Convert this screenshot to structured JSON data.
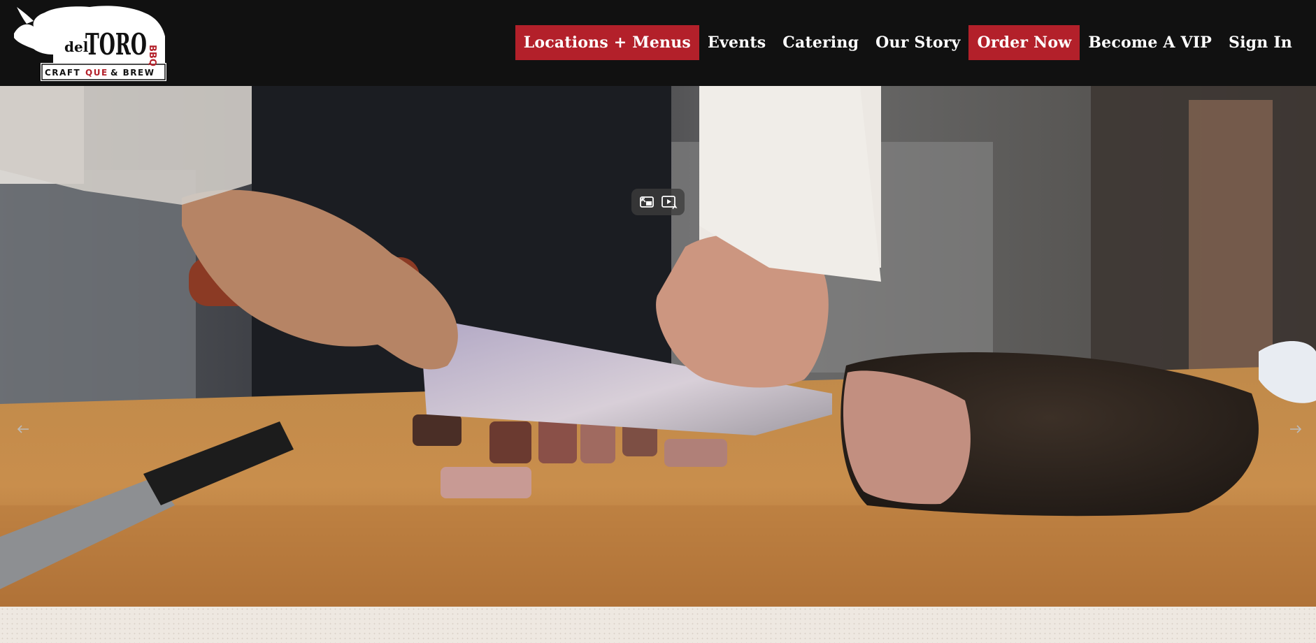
{
  "brand": {
    "logo_text_small": "del",
    "logo_text_big": "TORO",
    "logo_text_side": "BBQ",
    "tagline_part1": "CRAFT",
    "tagline_que": "QUE",
    "tagline_part2": "& BREW",
    "logo_icon": "bull-icon"
  },
  "nav": {
    "items": [
      {
        "label": "Locations + Menus",
        "highlight": true
      },
      {
        "label": "Events",
        "highlight": false
      },
      {
        "label": "Catering",
        "highlight": false
      },
      {
        "label": "Our Story",
        "highlight": false
      },
      {
        "label": "Order Now",
        "highlight": true
      },
      {
        "label": "Become A VIP",
        "highlight": false
      },
      {
        "label": "Sign In",
        "highlight": false
      }
    ]
  },
  "hero": {
    "media": "video of brisket being sliced on a cutting board",
    "controls": {
      "exit_icon": "picture-in-picture-exit-icon",
      "play_icon": "video-play-icon"
    },
    "prev_icon": "arrow-left-icon",
    "next_icon": "arrow-right-icon",
    "scroll_icon": "chevron-down-icon",
    "pause_icon": "pause-icon"
  },
  "colors": {
    "topbar": "#111111",
    "accent_red": "#b3202a",
    "nav_text": "#ffffff",
    "below_bg": "#eee8e1"
  }
}
